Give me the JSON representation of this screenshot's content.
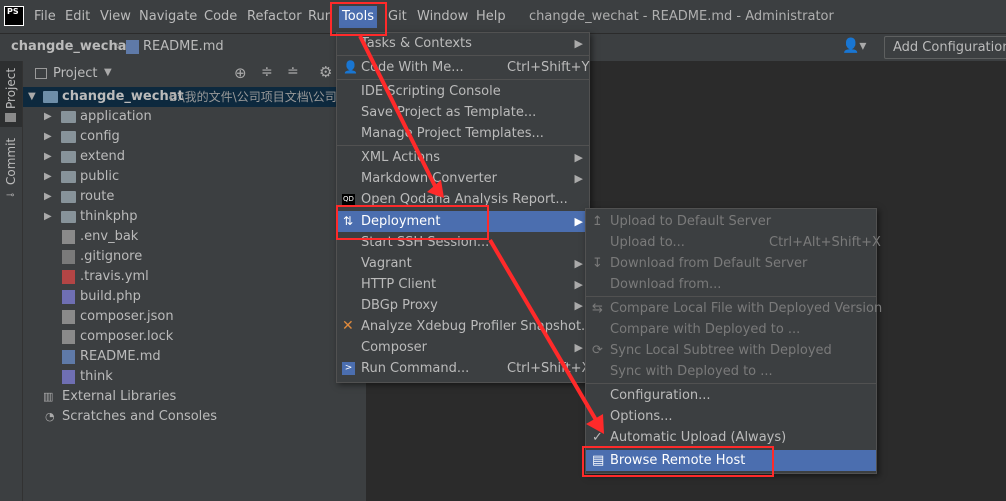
{
  "app": {
    "logo": "PS",
    "window_title": "changde_wechat - README.md - Administrator"
  },
  "menubar": [
    "File",
    "Edit",
    "View",
    "Navigate",
    "Code",
    "Refactor",
    "Run",
    "Tools",
    "Git",
    "Window",
    "Help"
  ],
  "navbar": {
    "project": "changde_wechat",
    "file": "README.md",
    "add_config": "Add Configuration..."
  },
  "leftstrip": {
    "project": "Project",
    "commit": "Commit"
  },
  "project_panel": {
    "title": "Project",
    "root_name": "changde_wechat",
    "root_path": "E:\\我的文件\\公司项目文档\\公司",
    "folders": [
      "application",
      "config",
      "extend",
      "public",
      "route",
      "thinkphp"
    ],
    "files": [
      ".env_bak",
      ".gitignore",
      ".travis.yml",
      "build.php",
      "composer.json",
      "composer.lock",
      "README.md",
      "think"
    ],
    "extras": [
      "External Libraries",
      "Scratches and Consoles"
    ]
  },
  "tools_menu": {
    "items": [
      {
        "label": "Tasks & Contexts",
        "submenu": true
      },
      {
        "label": "Code With Me...",
        "shortcut": "Ctrl+Shift+Y"
      },
      {
        "label": "IDE Scripting Console"
      },
      {
        "label": "Save Project as Template..."
      },
      {
        "label": "Manage Project Templates..."
      },
      {
        "label": "XML Actions",
        "submenu": true
      },
      {
        "label": "Markdown Converter",
        "submenu": true
      },
      {
        "label": "Open Qodana Analysis Report..."
      },
      {
        "label": "Deployment",
        "submenu": true,
        "selected": true
      },
      {
        "label": "Start SSH Session..."
      },
      {
        "label": "Vagrant",
        "submenu": true
      },
      {
        "label": "HTTP Client",
        "submenu": true
      },
      {
        "label": "DBGp Proxy",
        "submenu": true
      },
      {
        "label": "Analyze Xdebug Profiler Snapshot..."
      },
      {
        "label": "Composer",
        "submenu": true
      },
      {
        "label": "Run Command...",
        "shortcut": "Ctrl+Shift+X"
      }
    ]
  },
  "deployment_menu": {
    "items": [
      {
        "label": "Upload to Default Server",
        "disabled": true
      },
      {
        "label": "Upload to...",
        "shortcut": "Ctrl+Alt+Shift+X",
        "disabled": true
      },
      {
        "label": "Download from Default Server",
        "disabled": true
      },
      {
        "label": "Download from...",
        "disabled": true
      },
      {
        "label": "Compare Local File with Deployed Version",
        "disabled": true
      },
      {
        "label": "Compare with Deployed to ...",
        "disabled": true
      },
      {
        "label": "Sync Local Subtree with Deployed",
        "disabled": true
      },
      {
        "label": "Sync with Deployed to ...",
        "disabled": true
      },
      {
        "label": "Configuration..."
      },
      {
        "label": "Options..."
      },
      {
        "label": "Automatic Upload (Always)",
        "checked": true
      },
      {
        "label": "Browse Remote Host",
        "selected": true
      }
    ]
  },
  "colors": {
    "highlight": "#4b6eaf",
    "annotation": "#ff2a2a"
  }
}
